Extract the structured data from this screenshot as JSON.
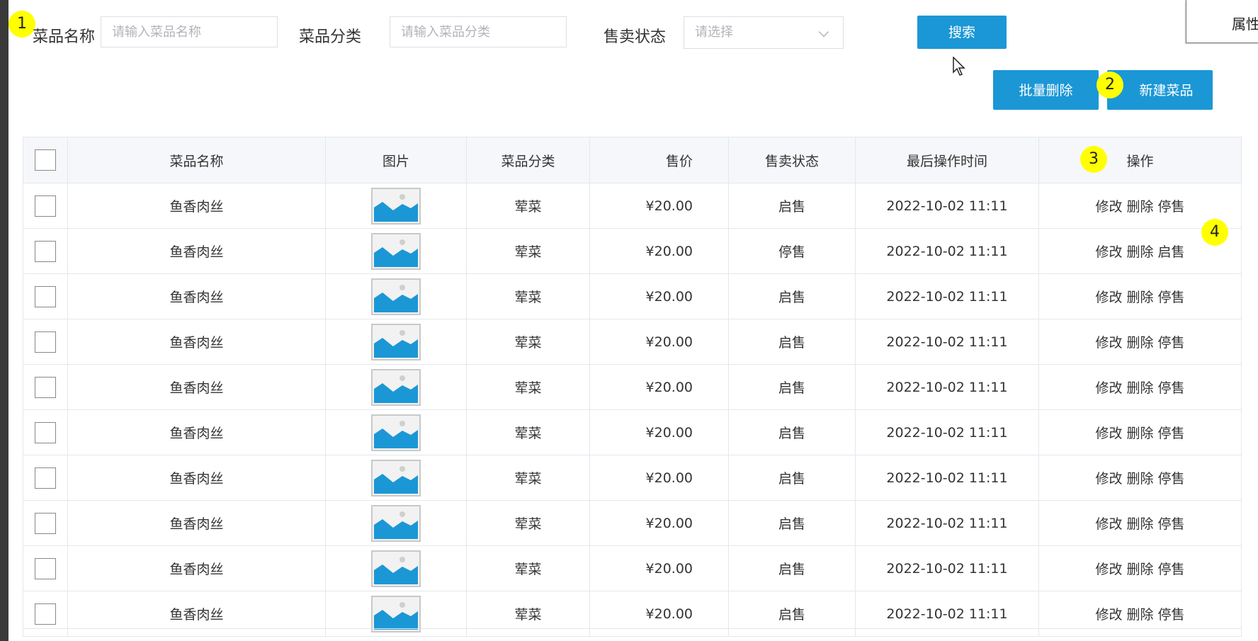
{
  "filters": {
    "name_label": "菜品名称",
    "name_placeholder": "请输入菜品名称",
    "category_label": "菜品分类",
    "category_placeholder": "请输入菜品分类",
    "status_label": "售卖状态",
    "status_placeholder": "请选择",
    "search_button": "搜索"
  },
  "toolbar": {
    "batch_delete": "批量删除",
    "new_dish": "新建菜品"
  },
  "side_panel": {
    "label": "属性"
  },
  "markers": [
    "1",
    "2",
    "3",
    "4"
  ],
  "table": {
    "headers": [
      "菜品名称",
      "图片",
      "菜品分类",
      "售价",
      "售卖状态",
      "最后操作时间",
      "操作"
    ],
    "rows": [
      {
        "name": "鱼香肉丝",
        "category": "荤菜",
        "price": "¥20.00",
        "status": "启售",
        "time": "2022-10-02 11:11",
        "op_edit": "修改",
        "op_delete": "删除",
        "op_toggle": "停售"
      },
      {
        "name": "鱼香肉丝",
        "category": "荤菜",
        "price": "¥20.00",
        "status": "停售",
        "time": "2022-10-02 11:11",
        "op_edit": "修改",
        "op_delete": "删除",
        "op_toggle": "启售"
      },
      {
        "name": "鱼香肉丝",
        "category": "荤菜",
        "price": "¥20.00",
        "status": "启售",
        "time": "2022-10-02 11:11",
        "op_edit": "修改",
        "op_delete": "删除",
        "op_toggle": "停售"
      },
      {
        "name": "鱼香肉丝",
        "category": "荤菜",
        "price": "¥20.00",
        "status": "启售",
        "time": "2022-10-02 11:11",
        "op_edit": "修改",
        "op_delete": "删除",
        "op_toggle": "停售"
      },
      {
        "name": "鱼香肉丝",
        "category": "荤菜",
        "price": "¥20.00",
        "status": "启售",
        "time": "2022-10-02 11:11",
        "op_edit": "修改",
        "op_delete": "删除",
        "op_toggle": "停售"
      },
      {
        "name": "鱼香肉丝",
        "category": "荤菜",
        "price": "¥20.00",
        "status": "启售",
        "time": "2022-10-02 11:11",
        "op_edit": "修改",
        "op_delete": "删除",
        "op_toggle": "停售"
      },
      {
        "name": "鱼香肉丝",
        "category": "荤菜",
        "price": "¥20.00",
        "status": "启售",
        "time": "2022-10-02 11:11",
        "op_edit": "修改",
        "op_delete": "删除",
        "op_toggle": "停售"
      },
      {
        "name": "鱼香肉丝",
        "category": "荤菜",
        "price": "¥20.00",
        "status": "启售",
        "time": "2022-10-02 11:11",
        "op_edit": "修改",
        "op_delete": "删除",
        "op_toggle": "停售"
      },
      {
        "name": "鱼香肉丝",
        "category": "荤菜",
        "price": "¥20.00",
        "status": "启售",
        "time": "2022-10-02 11:11",
        "op_edit": "修改",
        "op_delete": "删除",
        "op_toggle": "停售"
      },
      {
        "name": "鱼香肉丝",
        "category": "荤菜",
        "price": "¥20.00",
        "status": "启售",
        "time": "2022-10-02 11:11",
        "op_edit": "修改",
        "op_delete": "删除",
        "op_toggle": "停售"
      }
    ]
  },
  "colors": {
    "accent": "#1b97d6",
    "marker": "#ffff00",
    "header_bg": "#f5f7fa"
  }
}
